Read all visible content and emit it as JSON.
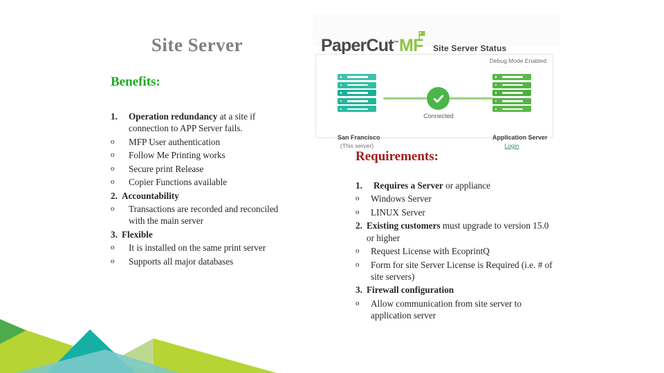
{
  "slide": {
    "title": "Site Server"
  },
  "benefits": {
    "heading": "Benefits:",
    "items": [
      {
        "marker": "1.",
        "level": 1,
        "strong": "Operation redundancy",
        "rest": " at a site if connection to APP Server fails."
      },
      {
        "marker": "o",
        "level": 2,
        "strong": "",
        "rest": "MFP User authentication"
      },
      {
        "marker": "o",
        "level": 2,
        "strong": "",
        "rest": "Follow Me Printing works"
      },
      {
        "marker": "o",
        "level": 2,
        "strong": "",
        "rest": "Secure print Release"
      },
      {
        "marker": "o",
        "level": 2,
        "strong": "",
        "rest": "Copier Functions available"
      },
      {
        "marker": "2.",
        "level": 1,
        "tight": true,
        "strong": "Accountability",
        "rest": ""
      },
      {
        "marker": "o",
        "level": 2,
        "strong": "",
        "rest": "Transactions are recorded and reconciled with the main server"
      },
      {
        "marker": "3.",
        "level": 1,
        "tight": true,
        "strong": "Flexible",
        "rest": ""
      },
      {
        "marker": "o",
        "level": 2,
        "strong": "",
        "rest": "It is installed on the same print server"
      },
      {
        "marker": "o",
        "level": 2,
        "strong": "",
        "rest": "Supports all major databases"
      }
    ]
  },
  "requirements": {
    "heading": "Requirements:",
    "items": [
      {
        "marker": "1.",
        "level": 1,
        "strong": "Requires a Server",
        "rest": " or appliance"
      },
      {
        "marker": "o",
        "level": 2,
        "strong": "",
        "rest": "Windows Server"
      },
      {
        "marker": "o",
        "level": 2,
        "strong": "",
        "rest": "LINUX Server"
      },
      {
        "marker": "2.",
        "level": 1,
        "tight": true,
        "strong": "Existing customers",
        "rest": " must upgrade to version 15.0 or higher"
      },
      {
        "marker": "o",
        "level": 2,
        "strong": "",
        "rest": "Request License with EcoprintQ"
      },
      {
        "marker": "o",
        "level": 2,
        "strong": "",
        "rest": "Form for site Server License is Required (i.e. # of site servers)"
      },
      {
        "marker": "3.",
        "level": 1,
        "tight": true,
        "strong": "Firewall configuration",
        "rest": ""
      },
      {
        "marker": "o",
        "level": 2,
        "strong": "",
        "rest": "Allow communication from site server to application server"
      }
    ]
  },
  "screenshot": {
    "logo_paper": "Paper",
    "logo_cut": "Cut",
    "logo_tm": "™",
    "logo_mf": "MF",
    "status_title": "Site Server Status",
    "debug_label": "Debug Mode Enabled",
    "connected_label": "Connected",
    "left_server": {
      "name": "San Francisco",
      "sub": "(This server)",
      "units": 5
    },
    "right_server": {
      "name": "Application Server",
      "link": "Login",
      "units": 5
    }
  },
  "colors": {
    "title_gray": "#7f7f7f",
    "benefits_green": "#1faa28",
    "requirements_red": "#a21d1d",
    "body_text": "#262626",
    "logo_green": "#8cc540",
    "status_green": "#49b649",
    "connector_green": "#9ecf86",
    "link_teal": "#2e8b78",
    "server_left_teal": "#26b397",
    "server_right_green": "#52b043",
    "deco_dark_green": "#4cab4c",
    "deco_yellow_green": "#b6d433",
    "deco_teal": "#14b0a4",
    "deco_light_teal": "#7dc9c9",
    "deco_pale_green": "#bcd98f"
  }
}
